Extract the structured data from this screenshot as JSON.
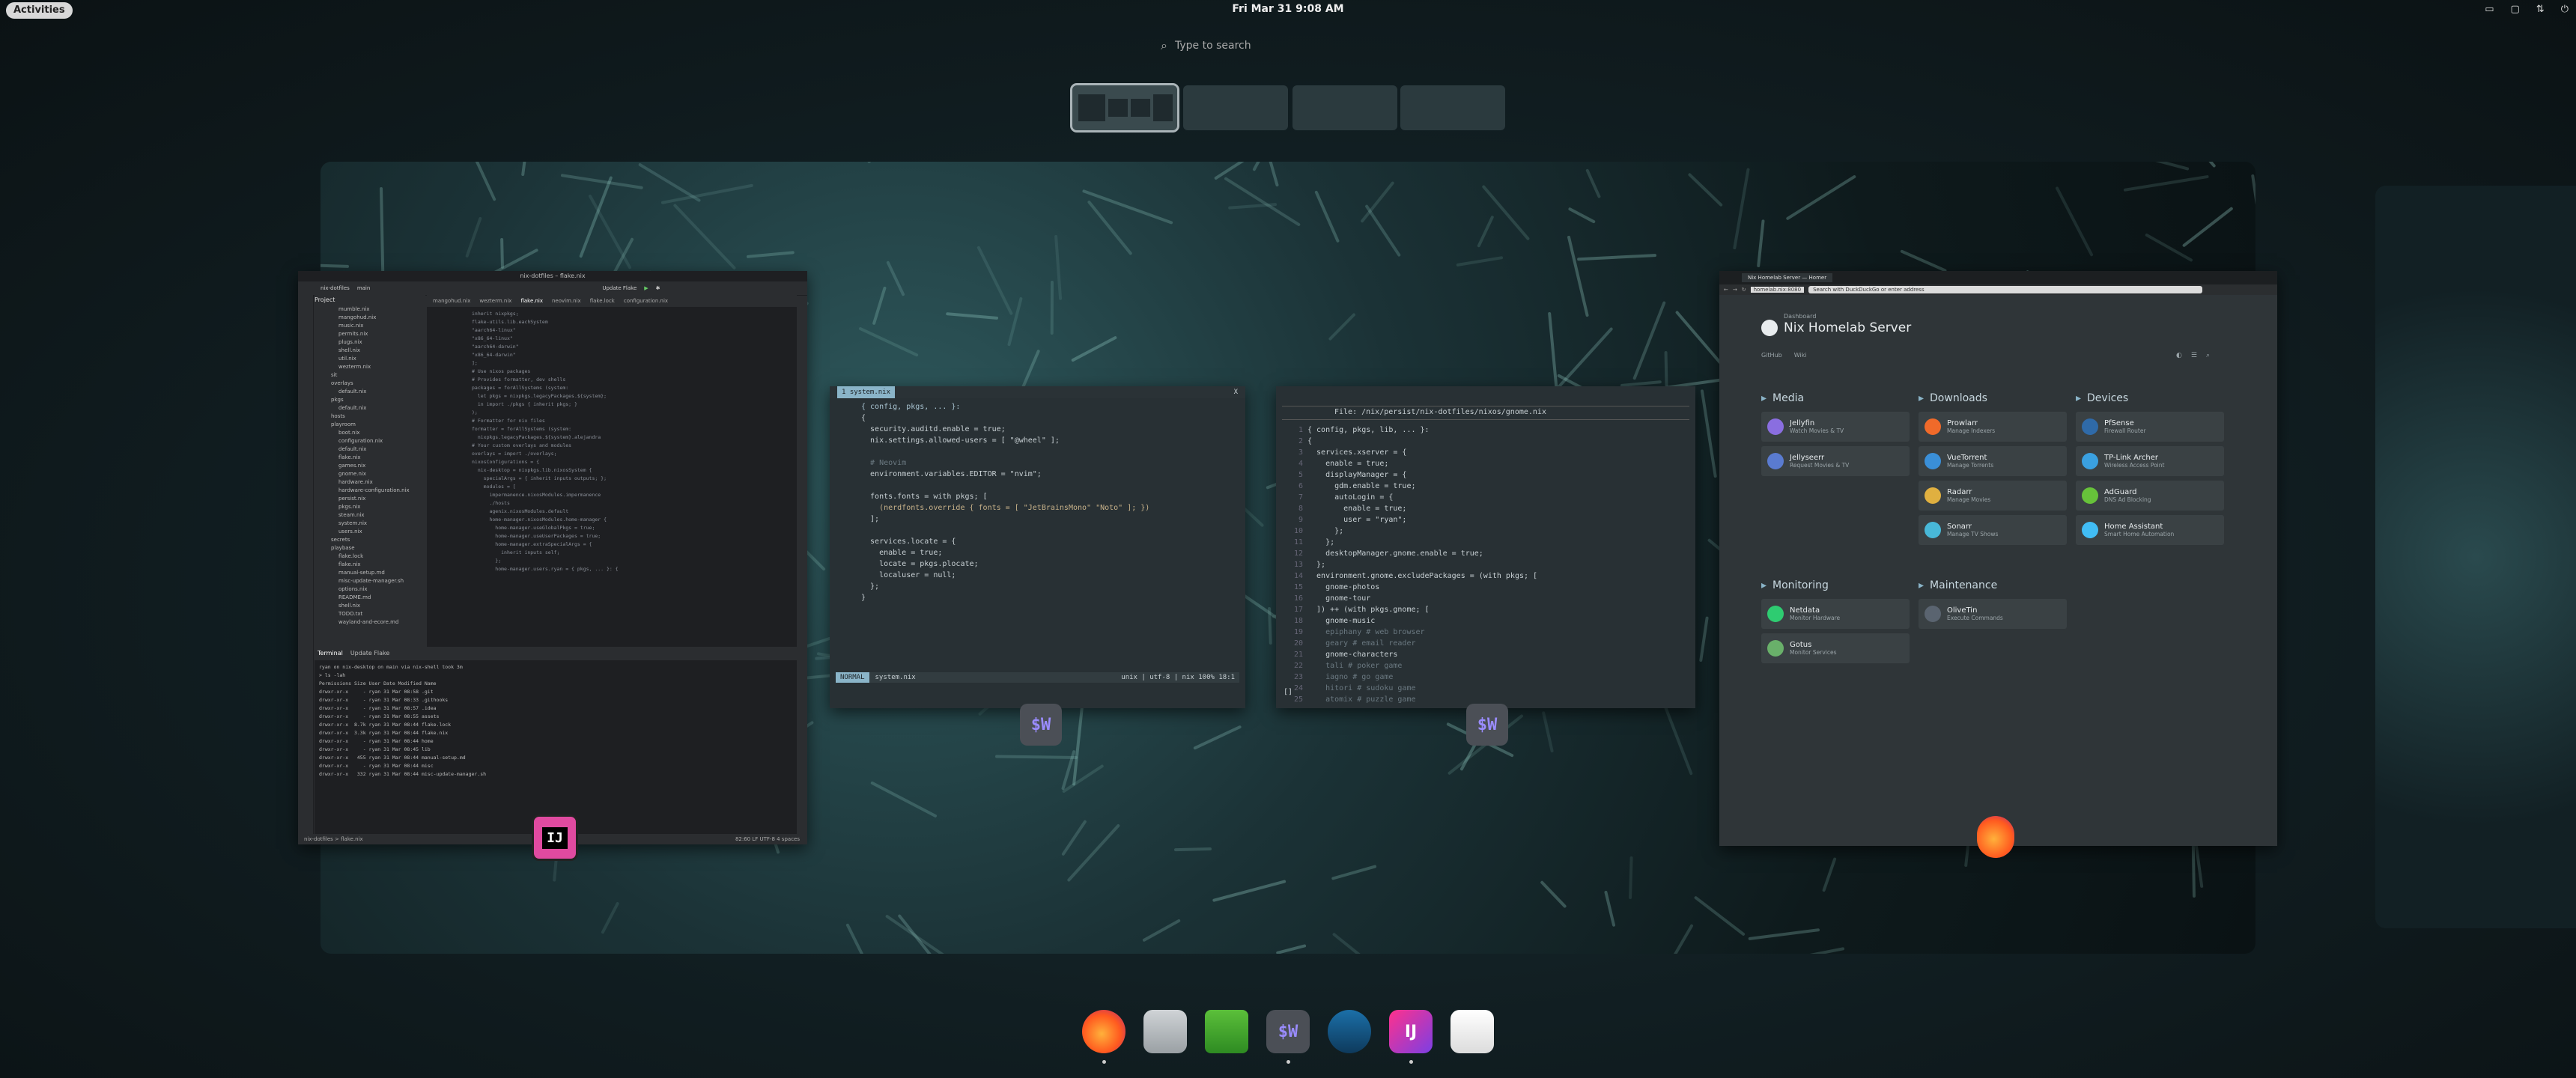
{
  "topbar": {
    "activities": "Activities",
    "clock": "Fri Mar 31  9:08 AM",
    "tray_icons": [
      "keyboard-layout-icon",
      "display-icon",
      "network-icon",
      "power-icon"
    ]
  },
  "overview": {
    "search_placeholder": "Type to search",
    "workspaces": 4,
    "active_workspace": 1
  },
  "intellij": {
    "window_title": "nix-dotfiles – flake.nix",
    "toolbar": [
      "nix-dotfiles",
      "main",
      "Update Flake"
    ],
    "project_label": "Project",
    "project_tree": [
      "mumble.nix",
      "mangohud.nix",
      "music.nix",
      "permits.nix",
      "plugs.nix",
      "shell.nix",
      "util.nix",
      "wezterm.nix",
      "sit",
      "overlays",
      "default.nix",
      "pkgs",
      "default.nix",
      "hosts",
      "playroom",
      "boot.nix",
      "configuration.nix",
      "default.nix",
      "flake.nix",
      "games.nix",
      "gnome.nix",
      "hardware.nix",
      "hardware-configuration.nix",
      "persist.nix",
      "pkgs.nix",
      "steam.nix",
      "system.nix",
      "users.nix",
      "secrets",
      "playbase",
      "flake.lock",
      "flake.nix",
      "manual-setup.md",
      "misc-update-manager.sh",
      "options.nix",
      "README.md",
      "shell.nix",
      "TODO.txt",
      "wayland-and-ecore.md"
    ],
    "tabs": [
      "mangohud.nix",
      "wezterm.nix",
      "flake.nix",
      "neovim.nix",
      "flake.lock",
      "configuration.nix"
    ],
    "code": [
      "inherit nixpkgs;",
      "flake-utils.lib.eachSystem",
      "",
      "\"aarch64-linux\"",
      "\"x86_64-linux\"",
      "\"aarch64-darwin\"",
      "\"x86_64-darwin\"",
      "];",
      "",
      "# Use nixos packages",
      "# Provides formatter, dev shells",
      "packages = forAllSystems (system:",
      "  let pkgs = nixpkgs.legacyPackages.${system};",
      "  in import ./pkgs { inherit pkgs; }",
      ");",
      "",
      "# Formatter for nix files",
      "formatter = forAllSystems (system:",
      "  nixpkgs.legacyPackages.${system}.alejandra",
      "",
      "# Your custom overlays and modules",
      "overlays = import ./overlays;",
      "nixosConfigurations = {",
      "  nix-desktop = nixpkgs.lib.nixosSystem {",
      "    specialArgs = { inherit inputs outputs; };",
      "    modules = [",
      "      impermanence.nixosModules.impermanence",
      "      ./hosts",
      "      agenix.nixosModules.default",
      "",
      "      home-manager.nixosModules.home-manager {",
      "        home-manager.useGlobalPkgs = true;",
      "        home-manager.useUserPackages = true;",
      "        home-manager.extraSpecialArgs = {",
      "          inherit inputs self;",
      "        };",
      "        home-manager.users.ryan = { pkgs, ... }: {"
    ],
    "terminal_tabs": [
      "Terminal",
      "Update Flake"
    ],
    "terminal_lines": [
      "ryan on nix-desktop on main via nix-shell took 3m",
      "> ls -lah",
      "Permissions Size User Date Modified Name",
      "drwxr-xr-x     - ryan 31 Mar 08:58 .git",
      "drwxr-xr-x     - ryan 31 Mar 08:33 .githooks",
      "drwxr-xr-x     - ryan 31 Mar 08:57 .idea",
      "drwxr-xr-x     - ryan 31 Mar 08:55 assets",
      "drwxr-xr-x  8.7k ryan 31 Mar 08:44 flake.lock",
      "drwxr-xr-x  3.3k ryan 31 Mar 08:44 flake.nix",
      "drwxr-xr-x     - ryan 31 Mar 08:44 home",
      "drwxr-xr-x     - ryan 31 Mar 08:45 lib",
      "drwxr-xr-x   455 ryan 31 Mar 08:44 manual-setup.md",
      "drwxr-xr-x     - ryan 31 Mar 08:44 misc",
      "drwxr-xr-x   332 ryan 31 Mar 08:44 misc-update-manager.sh"
    ],
    "status_left": "nix-dotfiles > flake.nix",
    "status_right": "82:60  LF  UTF-8  4 spaces"
  },
  "wez1": {
    "tab": "1  system.nix",
    "close": "X",
    "lines": [
      {
        "n": "",
        "t": "{ config, pkgs, ... }:",
        "c": "kw"
      },
      {
        "n": "",
        "t": "{",
        "c": ""
      },
      {
        "n": "",
        "t": "  security.auditd.enable = true;",
        "c": ""
      },
      {
        "n": "",
        "t": "  nix.settings.allowed-users = [ \"@wheel\" ];",
        "c": ""
      },
      {
        "n": "",
        "t": "",
        "c": ""
      },
      {
        "n": "",
        "t": "  # Neovim",
        "c": "cmt"
      },
      {
        "n": "",
        "t": "  environment.variables.EDITOR = \"nvim\";",
        "c": ""
      },
      {
        "n": "",
        "t": "",
        "c": ""
      },
      {
        "n": "",
        "t": "  fonts.fonts = with pkgs; [",
        "c": ""
      },
      {
        "n": "",
        "t": "    (nerdfonts.override { fonts = [ \"JetBrainsMono\" \"Noto\" ]; })",
        "c": "str"
      },
      {
        "n": "",
        "t": "  ];",
        "c": ""
      },
      {
        "n": "",
        "t": "",
        "c": ""
      },
      {
        "n": "",
        "t": "  services.locate = {",
        "c": ""
      },
      {
        "n": "",
        "t": "    enable = true;",
        "c": ""
      },
      {
        "n": "",
        "t": "    locate = pkgs.plocate;",
        "c": ""
      },
      {
        "n": "",
        "t": "    localuser = null;",
        "c": ""
      },
      {
        "n": "",
        "t": "  };",
        "c": ""
      },
      {
        "n": "",
        "t": "}",
        "c": ""
      }
    ],
    "status_mode": "NORMAL",
    "status_file": "system.nix",
    "status_right": "unix | utf-8 | nix  100%   18:1"
  },
  "wez2": {
    "header": "File: /nix/persist/nix-dotfiles/nixos/gnome.nix",
    "lines": [
      {
        "n": "1",
        "t": "{ config, pkgs, lib, ... }:",
        "c": ""
      },
      {
        "n": "2",
        "t": "{",
        "c": ""
      },
      {
        "n": "3",
        "t": "  services.xserver = {",
        "c": ""
      },
      {
        "n": "4",
        "t": "    enable = true;",
        "c": ""
      },
      {
        "n": "5",
        "t": "    displayManager = {",
        "c": ""
      },
      {
        "n": "6",
        "t": "      gdm.enable = true;",
        "c": ""
      },
      {
        "n": "7",
        "t": "      autoLogin = {",
        "c": ""
      },
      {
        "n": "8",
        "t": "        enable = true;",
        "c": ""
      },
      {
        "n": "9",
        "t": "        user = \"ryan\";",
        "c": ""
      },
      {
        "n": "10",
        "t": "      };",
        "c": ""
      },
      {
        "n": "11",
        "t": "    };",
        "c": ""
      },
      {
        "n": "12",
        "t": "    desktopManager.gnome.enable = true;",
        "c": ""
      },
      {
        "n": "13",
        "t": "  };",
        "c": ""
      },
      {
        "n": "14",
        "t": "  environment.gnome.excludePackages = (with pkgs; [",
        "c": ""
      },
      {
        "n": "15",
        "t": "    gnome-photos",
        "c": ""
      },
      {
        "n": "16",
        "t": "    gnome-tour",
        "c": ""
      },
      {
        "n": "17",
        "t": "  ]) ++ (with pkgs.gnome; [",
        "c": ""
      },
      {
        "n": "18",
        "t": "    gnome-music",
        "c": ""
      },
      {
        "n": "19",
        "t": "    epiphany # web browser",
        "c": "cmt"
      },
      {
        "n": "20",
        "t": "    geary # email reader",
        "c": "cmt"
      },
      {
        "n": "21",
        "t": "    gnome-characters",
        "c": ""
      },
      {
        "n": "22",
        "t": "    tali # poker game",
        "c": "cmt"
      },
      {
        "n": "23",
        "t": "    iagno # go game",
        "c": "cmt"
      },
      {
        "n": "24",
        "t": "    hitori # sudoku game",
        "c": "cmt"
      },
      {
        "n": "25",
        "t": "    atomix # puzzle game",
        "c": "cmt"
      }
    ],
    "prompt": "[]"
  },
  "firefox": {
    "tab": "Nix Homelab Server — Homer",
    "url": "homelab.nix:8080",
    "search_placeholder": "Search with DuckDuckGo or enter address",
    "site_subtitle": "Dashboard",
    "site_title": "Nix Homelab Server",
    "links": [
      "GitHub",
      "Wiki"
    ],
    "sections": [
      {
        "title": "Media",
        "items": [
          {
            "name": "Jellyfin",
            "desc": "Watch Movies & TV"
          },
          {
            "name": "Jellyseerr",
            "desc": "Request Movies & TV"
          }
        ]
      },
      {
        "title": "Downloads",
        "items": [
          {
            "name": "Prowlarr",
            "desc": "Manage Indexers"
          },
          {
            "name": "VueTorrent",
            "desc": "Manage Torrents"
          },
          {
            "name": "Radarr",
            "desc": "Manage Movies"
          },
          {
            "name": "Sonarr",
            "desc": "Manage TV Shows"
          }
        ]
      },
      {
        "title": "Devices",
        "items": [
          {
            "name": "PfSense",
            "desc": "Firewall Router"
          },
          {
            "name": "TP-Link Archer",
            "desc": "Wireless Access Point"
          },
          {
            "name": "AdGuard",
            "desc": "DNS Ad Blocking"
          },
          {
            "name": "Home Assistant",
            "desc": "Smart Home Automation"
          }
        ]
      },
      {
        "title": "Monitoring",
        "items": [
          {
            "name": "Netdata",
            "desc": "Monitor Hardware"
          },
          {
            "name": "Gotus",
            "desc": "Monitor Services"
          }
        ]
      },
      {
        "title": "Maintenance",
        "items": [
          {
            "name": "OliveTin",
            "desc": "Execute Commands"
          }
        ]
      }
    ]
  },
  "badges": {
    "intellij": "IJ",
    "wezterm": "$W"
  },
  "dock": [
    {
      "name": "firefox",
      "label": "",
      "running": true
    },
    {
      "name": "files",
      "label": "",
      "running": false
    },
    {
      "name": "cloud",
      "label": "",
      "running": false
    },
    {
      "name": "wezterm",
      "label": "$W",
      "running": true
    },
    {
      "name": "steam",
      "label": "",
      "running": false
    },
    {
      "name": "intellij",
      "label": "IJ",
      "running": true
    },
    {
      "name": "text-editor",
      "label": "",
      "running": false
    }
  ],
  "colors": {
    "accent": "#8ab4c8",
    "intellij_badge": "#d04a9a",
    "wezterm_badge": "#4b4f56",
    "firefox": "#ff7a1a"
  }
}
